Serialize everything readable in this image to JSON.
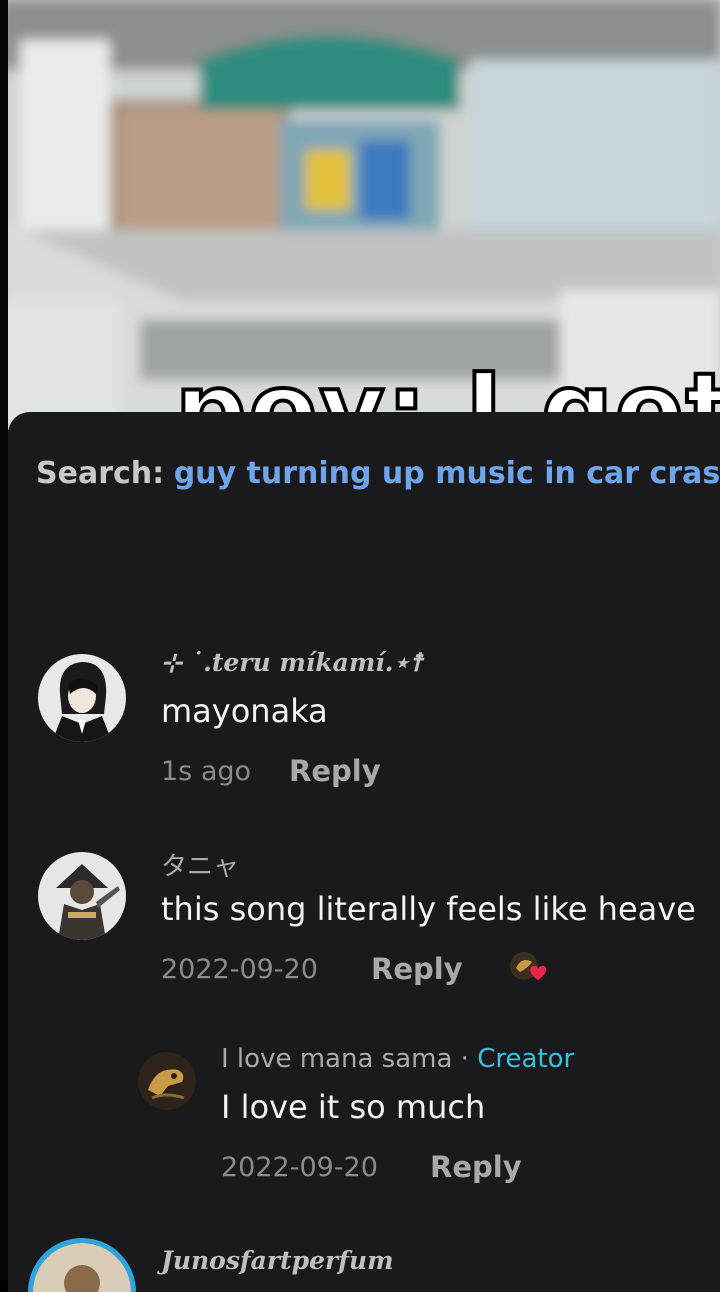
{
  "video": {
    "overlay_text": "pov: I got i"
  },
  "search": {
    "label": "Search:",
    "term": "guy turning up music in car crash"
  },
  "comments": [
    {
      "username": "⊹ ˙.teru míkamí.⋆☨",
      "text": "mayonaka",
      "time": "1s ago",
      "reply_label": "Reply"
    },
    {
      "username": "タニャ",
      "text": "this song literally feels like heave",
      "time": "2022-09-20",
      "reply_label": "Reply",
      "liked_by_creator": true,
      "replies": [
        {
          "username": "I love mana sama",
          "separator": "·",
          "badge": "Creator",
          "text": "I love it so much",
          "time": "2022-09-20",
          "reply_label": "Reply"
        }
      ]
    },
    {
      "username": "Junosfartperfum"
    }
  ],
  "colors": {
    "sheet_bg": "#1a1a1c",
    "search_term": "#6ea4ea",
    "creator_badge": "#35c2dc",
    "heart": "#e8274a"
  }
}
